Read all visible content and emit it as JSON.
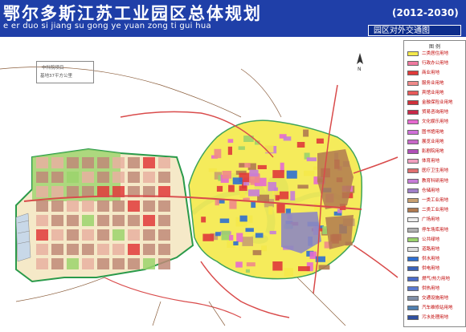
{
  "header": {
    "title": "鄂尔多斯江苏工业园区总体规划",
    "years": "(2012-2030)",
    "subtitle": "e er duo si jiang su gong ye yuan zong ti gui hua",
    "caption": "园区对外交通图"
  },
  "map": {
    "labels": [
      "中科院项目",
      "基地37平方公里"
    ],
    "colors": {
      "background": "#ffffff",
      "road": "#d94b4b",
      "arterial": "#8b5e3c",
      "water": "#69c8f0",
      "green": "#9bd36c",
      "industrial": "#b98a6a",
      "residential": "#f0e68c",
      "commercial": "#e05a7a",
      "education": "#c77dd8",
      "river_bed": "#c8e8c0"
    }
  },
  "legend": {
    "title": "图 例",
    "items": [
      {
        "label": "二类居住用地",
        "color": "#f5e94a"
      },
      {
        "label": "行政办公用地",
        "color": "#f07aa0"
      },
      {
        "label": "商业用地",
        "color": "#e03a3a"
      },
      {
        "label": "服务业用地",
        "color": "#f08a8a"
      },
      {
        "label": "宾馆业用地",
        "color": "#e85a5a"
      },
      {
        "label": "金融保险业用地",
        "color": "#d0303a"
      },
      {
        "label": "贸易咨询用地",
        "color": "#c82848"
      },
      {
        "label": "文化娱乐用地",
        "color": "#e66ad0"
      },
      {
        "label": "图书馆用地",
        "color": "#d070d8"
      },
      {
        "label": "展览业用地",
        "color": "#c868c8"
      },
      {
        "label": "影剧院用地",
        "color": "#b050b8"
      },
      {
        "label": "体育用地",
        "color": "#f0a0c0"
      },
      {
        "label": "医疗卫生用地",
        "color": "#e07070"
      },
      {
        "label": "教育科研用地",
        "color": "#c77dd8"
      },
      {
        "label": "仓储用地",
        "color": "#a080c8"
      },
      {
        "label": "一类工业用地",
        "color": "#c8a070"
      },
      {
        "label": "二类工业用地",
        "color": "#b07a50"
      },
      {
        "label": "广场用地",
        "color": "#eeeeee"
      },
      {
        "label": "停车场库用地",
        "color": "#b0b0b0"
      },
      {
        "label": "公共绿地",
        "color": "#9bd36c"
      },
      {
        "label": "道路用地",
        "color": "#dddddd"
      },
      {
        "label": "供水用地",
        "color": "#2f6fd0"
      },
      {
        "label": "供电用地",
        "color": "#3a62b8"
      },
      {
        "label": "燃气/热力用地",
        "color": "#4b6cc8"
      },
      {
        "label": "供热用地",
        "color": "#5a7ad0"
      },
      {
        "label": "交通设施用地",
        "color": "#8090a8"
      },
      {
        "label": "汽车维修站用地",
        "color": "#5080b0"
      },
      {
        "label": "污水处理用地",
        "color": "#3050a0"
      }
    ]
  }
}
